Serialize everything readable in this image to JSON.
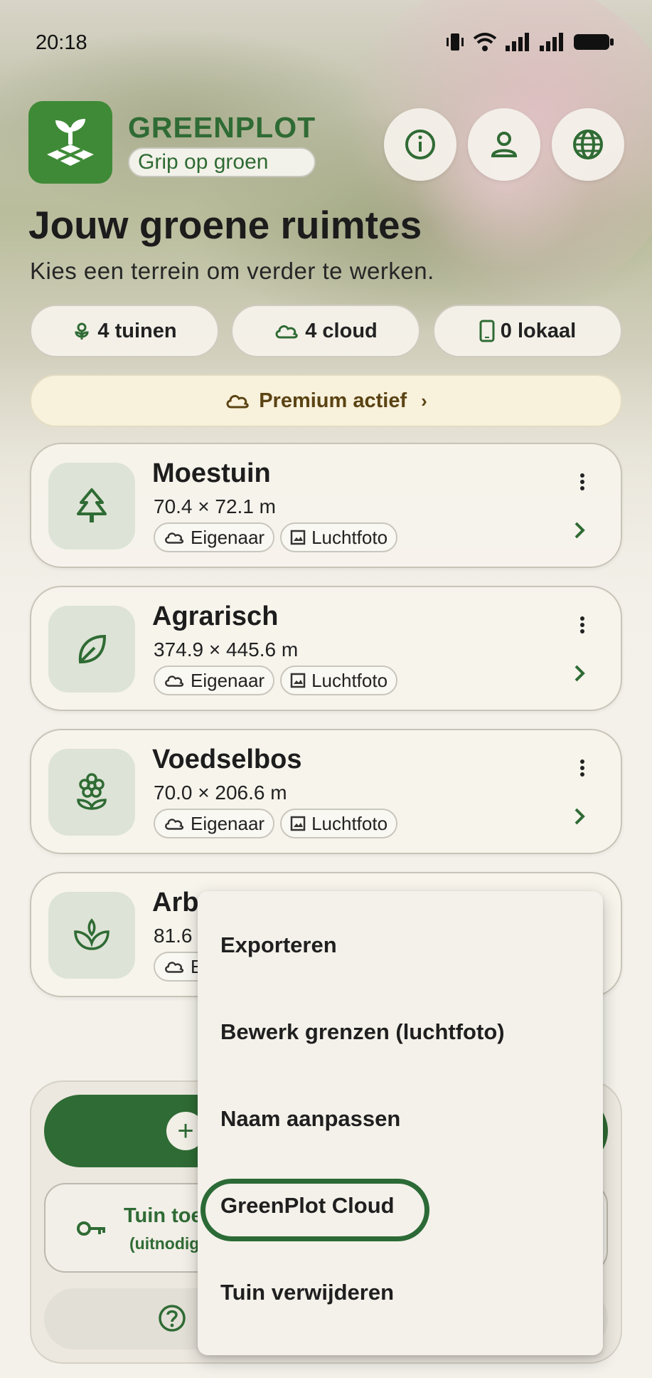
{
  "status_bar": {
    "time": "20:18"
  },
  "app": {
    "name": "GREENPLOT",
    "tagline": "Grip op groen"
  },
  "header_buttons": [
    {
      "name": "info-icon"
    },
    {
      "name": "account-icon"
    },
    {
      "name": "globe-icon"
    }
  ],
  "page": {
    "title": "Jouw groene ruimtes",
    "subtitle": "Kies een terrein om verder te werken."
  },
  "stats": {
    "gardens": "4 tuinen",
    "cloud": "4 cloud",
    "local": "0 lokaal"
  },
  "premium": {
    "label": "Premium actief"
  },
  "gardens": [
    {
      "title": "Moestuin",
      "dims": "70.4 × 72.1 m",
      "tag_owner": "Eigenaar",
      "tag_photo": "Luchtfoto",
      "icon": "tree-icon"
    },
    {
      "title": "Agrarisch",
      "dims": "374.9 × 445.6 m",
      "tag_owner": "Eigenaar",
      "tag_photo": "Luchtfoto",
      "icon": "leaf-icon"
    },
    {
      "title": "Voedselbos",
      "dims": "70.0 × 206.6 m",
      "tag_owner": "Eigenaar",
      "tag_photo": "Luchtfoto",
      "icon": "flower-icon"
    },
    {
      "title": "Arb",
      "dims": "81.6",
      "tag_owner": "E",
      "icon": "sprout-icon"
    }
  ],
  "bottom": {
    "invite_title": "Tuin toe",
    "invite_sub": "(uitnodig",
    "help_label": "H"
  },
  "context_menu": {
    "items": [
      "Exporteren",
      "Bewerk grenzen (luchtfoto)",
      "Naam aanpassen",
      "GreenPlot Cloud",
      "Tuin verwijderen"
    ],
    "highlighted": "GreenPlot Cloud"
  },
  "colors": {
    "brand_green": "#2f6b34",
    "logo_green": "#3f8a37",
    "premium_bg": "#f8f1dc"
  }
}
